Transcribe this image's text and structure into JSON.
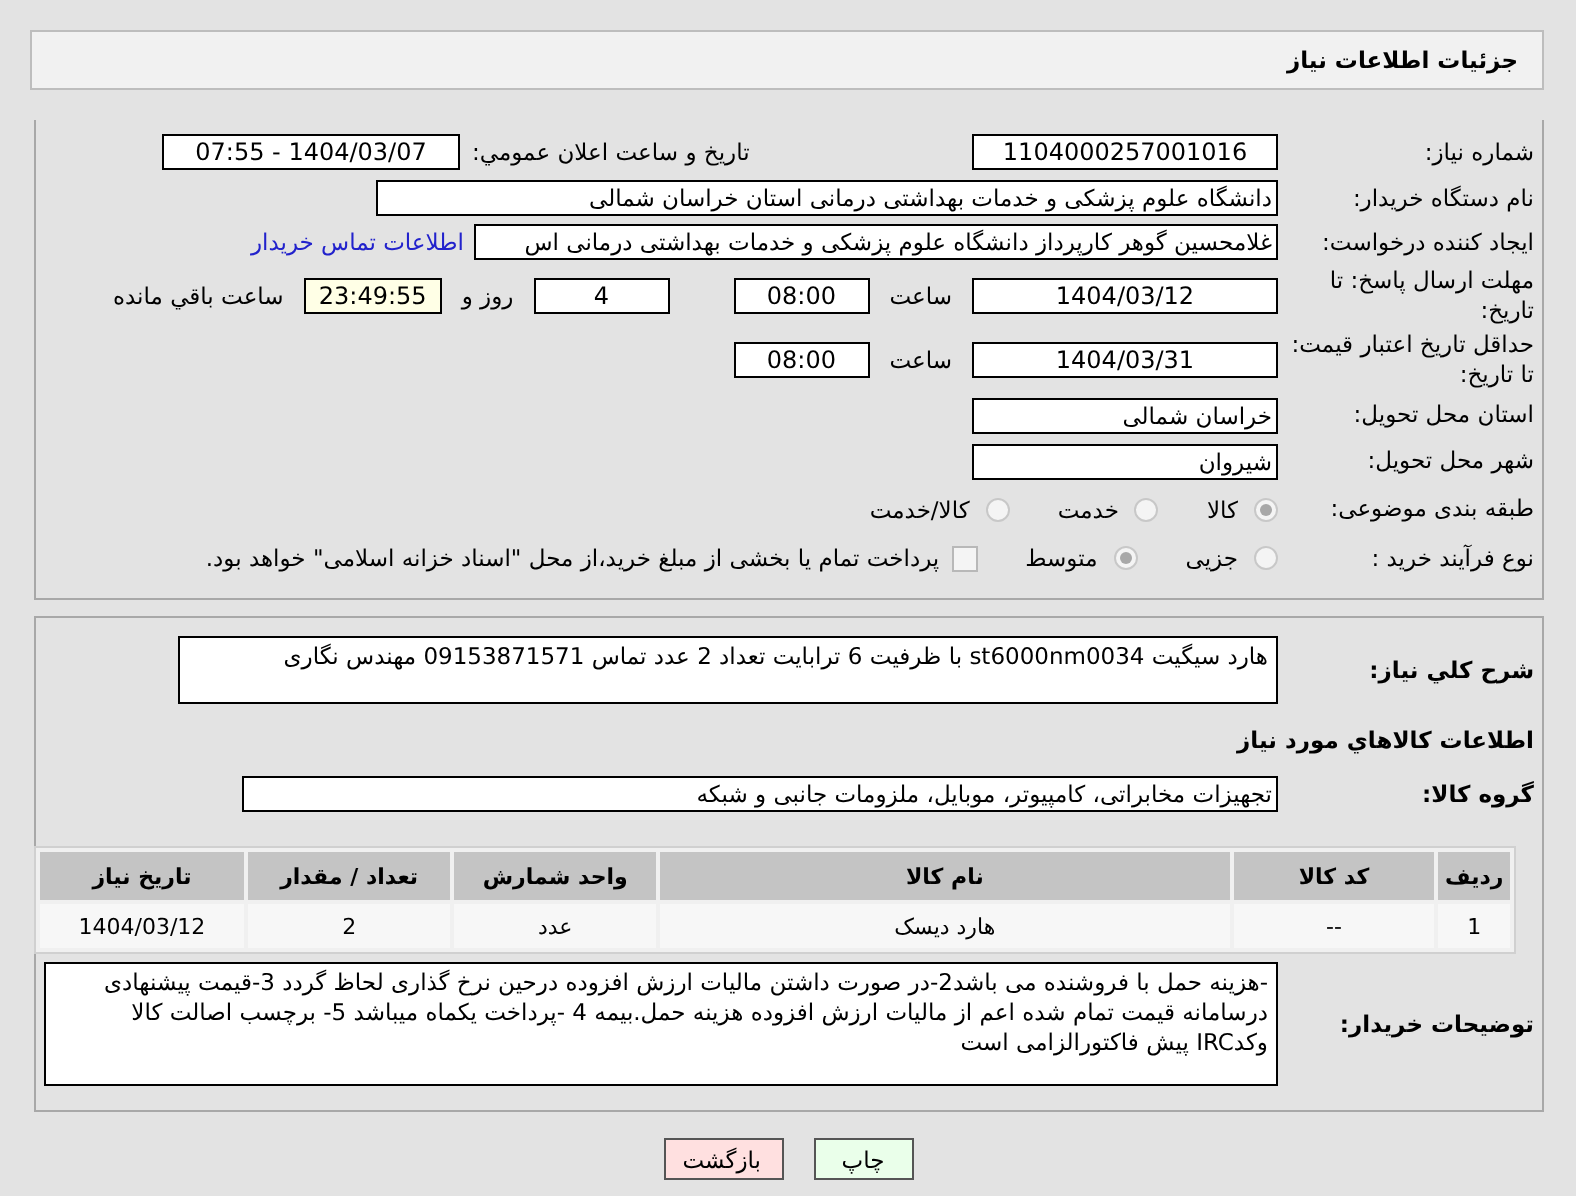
{
  "header": {
    "title": "جزئیات اطلاعات نیاز"
  },
  "need_number": {
    "label": "شماره نیاز:",
    "value": "1104000257001016"
  },
  "announce": {
    "label": "تاريخ و ساعت اعلان عمومي:",
    "value": "1404/03/07 - 07:55"
  },
  "buyer_org": {
    "label": "نام دستگاه خریدار:",
    "value": "دانشگاه علوم پزشکی و خدمات بهداشتی درمانی استان خراسان شمالی"
  },
  "requester": {
    "label": "ایجاد کننده درخواست:",
    "value": "غلامحسین گوهر کارپرداز  دانشگاه علوم پزشکی و خدمات بهداشتی درمانی اس",
    "contact_link": "اطلاعات تماس خریدار"
  },
  "response_deadline": {
    "label": "مهلت ارسال پاسخ: تا تاریخ:",
    "date": "1404/03/12",
    "time_label": "ساعت",
    "time": "08:00",
    "days": "4",
    "days_label": "روز و",
    "remaining": "23:49:55",
    "remaining_label": "ساعت باقي مانده"
  },
  "price_validity": {
    "label": "حداقل تاریخ اعتبار قیمت: تا تاریخ:",
    "date": "1404/03/31",
    "time_label": "ساعت",
    "time": "08:00"
  },
  "province": {
    "label": "استان محل تحویل:",
    "value": "خراسان شمالی"
  },
  "city": {
    "label": "شهر محل تحویل:",
    "value": "شیروان"
  },
  "category": {
    "label": "طبقه بندی موضوعی:",
    "options": [
      {
        "label": "کالا",
        "selected": true
      },
      {
        "label": "خدمت",
        "selected": false
      },
      {
        "label": "کالا/خدمت",
        "selected": false
      }
    ]
  },
  "process": {
    "label": "نوع فرآیند خرید :",
    "options": [
      {
        "label": "جزیی",
        "selected": false
      },
      {
        "label": "متوسط",
        "selected": true
      }
    ],
    "treasury": {
      "label": "پرداخت تمام یا بخشی از مبلغ خرید،از محل \"اسناد خزانه اسلامی\" خواهد بود.",
      "checked": false
    }
  },
  "description": {
    "label": "شرح کلي نياز:",
    "value": "هارد سیگیت st6000nm0034 با ظرفیت 6 ترابایت  تعداد 2 عدد تماس 09153871571 مهندس نگاری"
  },
  "goods_heading": "اطلاعات کالاهاي مورد نياز",
  "goods_group": {
    "label": "گروه کالا:",
    "value": "تجهیزات مخابراتی، کامپیوتر، موبایل، ملزومات جانبی و شبکه"
  },
  "table": {
    "columns": [
      "ردیف",
      "کد کالا",
      "نام کالا",
      "واحد شمارش",
      "تعداد / مقدار",
      "تاریخ نیاز"
    ],
    "rows": [
      [
        "1",
        "--",
        "هارد دیسک",
        "عدد",
        "2",
        "1404/03/12"
      ]
    ]
  },
  "buyer_notes": {
    "label": "توضیحات خریدار:",
    "value": "-هزینه حمل با فروشنده می باشد2-در صورت داشتن مالیات ارزش افزوده درحین نرخ گذاری لحاظ گردد 3-قیمت پیشنهادی درسامانه  قیمت تمام شده اعم از مالیات ارزش افزوده هزینه حمل.بیمه 4 -پرداخت یکماه میباشد 5- برچسب اصالت کالا وکدIRC پیش فاکتورالزامی است"
  },
  "buttons": [
    {
      "label": "چاپ",
      "kind": "print"
    },
    {
      "label": "بازگشت",
      "kind": "back"
    }
  ]
}
